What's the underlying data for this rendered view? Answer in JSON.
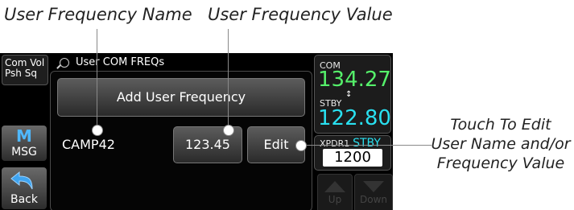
{
  "callouts": {
    "user_frequency_name": "User Frequency Name",
    "user_frequency_value": "User Frequency Value",
    "touch_to_edit_line1": "Touch To Edit",
    "touch_to_edit_line2": "User Name and/or",
    "touch_to_edit_line3": "Frequency Value"
  },
  "left_buttons": {
    "com_vol_line1": "Com Vol",
    "com_vol_line2": "Psh Sq",
    "msg_label": "MSG",
    "back_label": "Back"
  },
  "page_title": "User COM FREQs",
  "add_button_label": "Add User Frequency",
  "entries": [
    {
      "name": "CAMP42",
      "value": "123.45",
      "edit_label": "Edit"
    }
  ],
  "radio": {
    "com_label": "COM",
    "com_active": "134.27",
    "stby_label": "STBY",
    "com_standby": "122.80",
    "xpdr_label": "XPDR1",
    "xpdr_mode": "STBY",
    "xpdr_code": "1200",
    "up_label": "Up",
    "down_label": "Down"
  },
  "colors": {
    "active_freq": "#55f06a",
    "standby_freq": "#29e0f0",
    "screen_bg": "#000000"
  }
}
